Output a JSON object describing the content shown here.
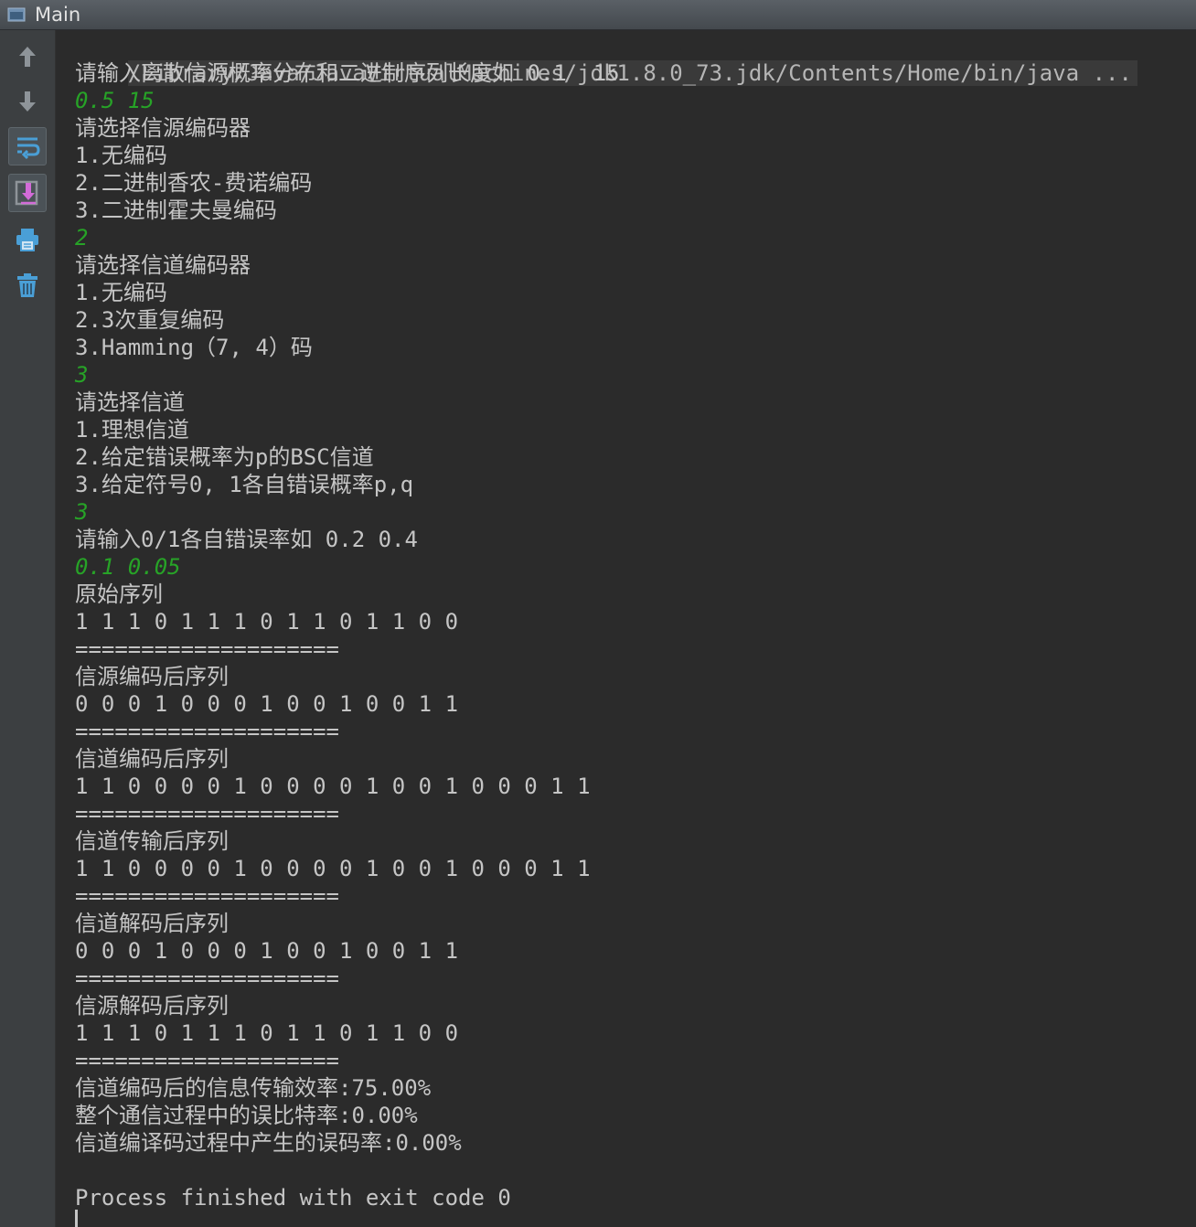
{
  "window": {
    "title": "Main"
  },
  "toolbar": [
    {
      "name": "scroll-up-icon",
      "icon": "arrow-up"
    },
    {
      "name": "scroll-down-icon",
      "icon": "arrow-down"
    },
    {
      "name": "soft-wrap-icon",
      "icon": "soft-wrap"
    },
    {
      "name": "scroll-to-end-icon",
      "icon": "scroll-to-end"
    },
    {
      "name": "print-icon",
      "icon": "printer"
    },
    {
      "name": "clear-all-icon",
      "icon": "trash"
    }
  ],
  "console": {
    "command": "/Library/Java/JavaVirtualMachines/jdk1.8.0_73.jdk/Contents/Home/bin/java ...",
    "lines": [
      {
        "text": "请输入离散信源概率分布和二进制序列长度如 0.1  15",
        "kind": "out"
      },
      {
        "text": "0.5 15",
        "kind": "input"
      },
      {
        "text": "请选择信源编码器",
        "kind": "out"
      },
      {
        "text": "1.无编码",
        "kind": "out"
      },
      {
        "text": "2.二进制香农-费诺编码",
        "kind": "out"
      },
      {
        "text": "3.二进制霍夫曼编码",
        "kind": "out"
      },
      {
        "text": "2",
        "kind": "input"
      },
      {
        "text": "请选择信道编码器",
        "kind": "out"
      },
      {
        "text": "1.无编码",
        "kind": "out"
      },
      {
        "text": "2.3次重复编码",
        "kind": "out"
      },
      {
        "text": "3.Hamming（7, 4）码",
        "kind": "out"
      },
      {
        "text": "3",
        "kind": "input"
      },
      {
        "text": "请选择信道",
        "kind": "out"
      },
      {
        "text": "1.理想信道",
        "kind": "out"
      },
      {
        "text": "2.给定错误概率为p的BSC信道",
        "kind": "out"
      },
      {
        "text": "3.给定符号0, 1各自错误概率p,q",
        "kind": "out"
      },
      {
        "text": "3",
        "kind": "input"
      },
      {
        "text": "请输入0/1各自错误率如 0.2 0.4",
        "kind": "out"
      },
      {
        "text": "0.1 0.05",
        "kind": "input"
      },
      {
        "text": "原始序列",
        "kind": "out"
      },
      {
        "text": "1 1 1 0 1 1 1 0 1 1 0 1 1 0 0",
        "kind": "out"
      },
      {
        "text": "====================",
        "kind": "out"
      },
      {
        "text": "信源编码后序列",
        "kind": "out"
      },
      {
        "text": "0 0 0 1 0 0 0 1 0 0 1 0 0 1 1",
        "kind": "out"
      },
      {
        "text": "====================",
        "kind": "out"
      },
      {
        "text": "信道编码后序列",
        "kind": "out"
      },
      {
        "text": "1 1 0 0 0 0 1 0 0 0 0 1 0 0 1 0 0 0 1 1",
        "kind": "out"
      },
      {
        "text": "====================",
        "kind": "out"
      },
      {
        "text": "信道传输后序列",
        "kind": "out"
      },
      {
        "text": "1 1 0 0 0 0 1 0 0 0 0 1 0 0 1 0 0 0 1 1",
        "kind": "out"
      },
      {
        "text": "====================",
        "kind": "out"
      },
      {
        "text": "信道解码后序列",
        "kind": "out"
      },
      {
        "text": "0 0 0 1 0 0 0 1 0 0 1 0 0 1 1",
        "kind": "out"
      },
      {
        "text": "====================",
        "kind": "out"
      },
      {
        "text": "信源解码后序列",
        "kind": "out"
      },
      {
        "text": "1 1 1 0 1 1 1 0 1 1 0 1 1 0 0",
        "kind": "out"
      },
      {
        "text": "====================",
        "kind": "out"
      },
      {
        "text": "信道编码后的信息传输效率:75.00%",
        "kind": "out"
      },
      {
        "text": "整个通信过程中的误比特率:0.00%",
        "kind": "out"
      },
      {
        "text": "信道编译码过程中产生的误码率:0.00%",
        "kind": "out"
      },
      {
        "text": "",
        "kind": "out"
      },
      {
        "text": "Process finished with exit code 0",
        "kind": "out"
      }
    ]
  },
  "colors": {
    "background": "#2b2b2b",
    "output_text": "#c5c5c5",
    "user_input": "#27a327",
    "gutter": "#3c3f41",
    "icon_gray": "#8e9499",
    "icon_blue": "#4a9fd6",
    "icon_pink": "#d36bd8"
  }
}
